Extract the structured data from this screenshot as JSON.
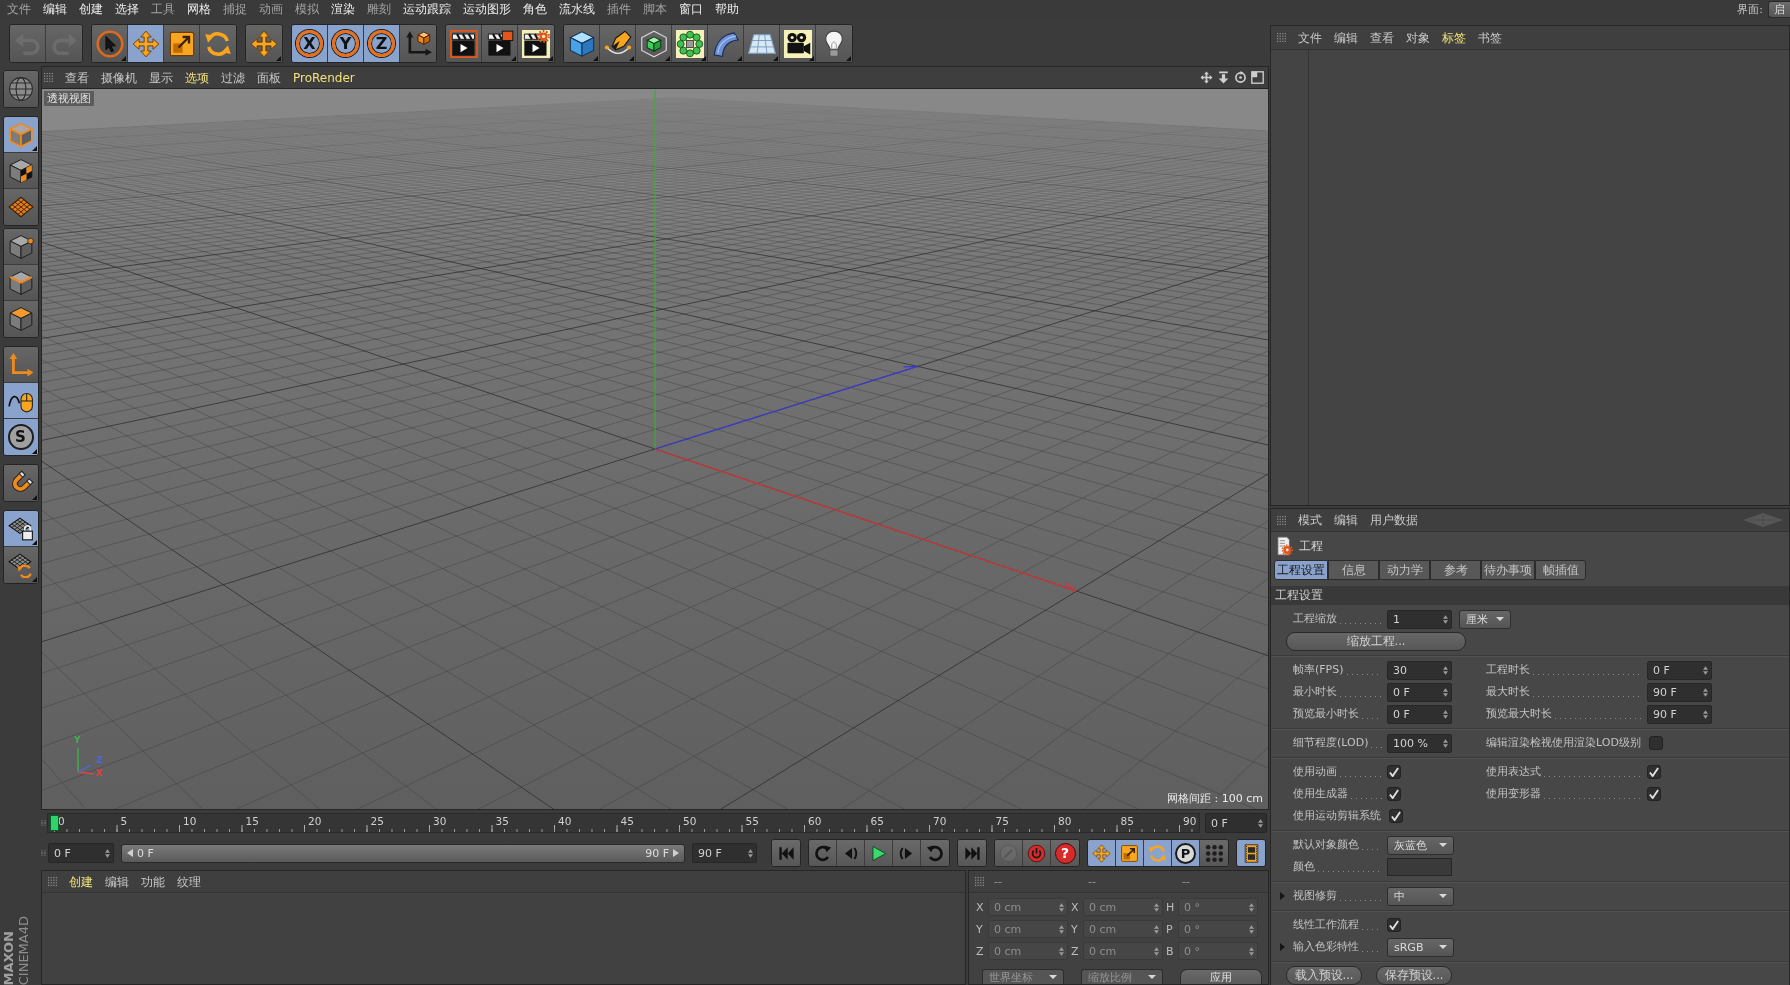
{
  "menu_bar": {
    "items": [
      {
        "label": "文件",
        "dimmed": true
      },
      {
        "label": "编辑",
        "dimmed": false
      },
      {
        "label": "创建",
        "dimmed": false
      },
      {
        "label": "选择",
        "dimmed": false
      },
      {
        "label": "工具",
        "dimmed": true
      },
      {
        "label": "网格",
        "dimmed": false
      },
      {
        "label": "捕捉",
        "dimmed": true
      },
      {
        "label": "动画",
        "dimmed": true
      },
      {
        "label": "模拟",
        "dimmed": true
      },
      {
        "label": "渲染",
        "dimmed": false
      },
      {
        "label": "雕刻",
        "dimmed": true
      },
      {
        "label": "运动跟踪",
        "dimmed": false
      },
      {
        "label": "运动图形",
        "dimmed": false
      },
      {
        "label": "角色",
        "dimmed": false
      },
      {
        "label": "流水线",
        "dimmed": false
      },
      {
        "label": "插件",
        "dimmed": true
      },
      {
        "label": "脚本",
        "dimmed": true
      },
      {
        "label": "窗口",
        "dimmed": false
      },
      {
        "label": "帮助",
        "dimmed": false
      }
    ],
    "layout_label": "界面:",
    "layout_value": "启"
  },
  "main_toolbar": {
    "groups": [
      [
        {
          "kind": "undo",
          "selected": false,
          "disabled": true,
          "submenu": false
        },
        {
          "kind": "redo",
          "selected": false,
          "disabled": true,
          "submenu": false
        }
      ],
      [
        {
          "kind": "live-select",
          "selected": false,
          "disabled": false,
          "submenu": true
        },
        {
          "kind": "move",
          "selected": true,
          "disabled": false,
          "submenu": false
        },
        {
          "kind": "scale",
          "selected": false,
          "disabled": false,
          "submenu": false
        },
        {
          "kind": "rotate",
          "selected": false,
          "disabled": false,
          "submenu": false
        }
      ],
      [
        {
          "kind": "last-tool",
          "selected": false,
          "disabled": false,
          "submenu": true
        }
      ],
      [
        {
          "kind": "axis",
          "label": "X",
          "selected": true,
          "disabled": false,
          "submenu": false
        },
        {
          "kind": "axis",
          "label": "Y",
          "selected": true,
          "disabled": false,
          "submenu": false
        },
        {
          "kind": "axis",
          "label": "Z",
          "selected": true,
          "disabled": false,
          "submenu": false
        },
        {
          "kind": "world-coords",
          "selected": false,
          "disabled": false,
          "submenu": false
        }
      ],
      [
        {
          "kind": "render-view",
          "selected": false,
          "disabled": false,
          "submenu": false
        },
        {
          "kind": "render-viewer",
          "selected": false,
          "disabled": false,
          "submenu": true
        },
        {
          "kind": "render-settings",
          "selected": false,
          "disabled": false,
          "submenu": true
        }
      ],
      [
        {
          "kind": "cube",
          "selected": false,
          "disabled": false,
          "submenu": true
        },
        {
          "kind": "pen",
          "selected": false,
          "disabled": false,
          "submenu": true
        },
        {
          "kind": "subdivision",
          "selected": false,
          "disabled": false,
          "submenu": true
        },
        {
          "kind": "cloner",
          "selected": false,
          "disabled": false,
          "submenu": true
        },
        {
          "kind": "bend",
          "selected": false,
          "disabled": false,
          "submenu": true
        },
        {
          "kind": "floor",
          "selected": false,
          "disabled": false,
          "submenu": true
        },
        {
          "kind": "camera",
          "selected": false,
          "disabled": false,
          "submenu": true
        },
        {
          "kind": "light",
          "selected": false,
          "disabled": false,
          "submenu": true
        }
      ]
    ]
  },
  "left_toolbar": {
    "groups": [
      [
        {
          "kind": "make-editable",
          "selected": false,
          "submenu": false
        }
      ],
      [
        {
          "kind": "model",
          "selected": true,
          "submenu": true
        },
        {
          "kind": "texture",
          "selected": false,
          "submenu": false
        },
        {
          "kind": "workplane",
          "selected": false,
          "submenu": false
        }
      ],
      [
        {
          "kind": "points",
          "selected": false,
          "submenu": false
        },
        {
          "kind": "edges",
          "selected": false,
          "submenu": false
        },
        {
          "kind": "polygons",
          "selected": false,
          "submenu": false
        }
      ],
      [
        {
          "kind": "axis-mode",
          "selected": false,
          "submenu": false
        },
        {
          "kind": "tweak",
          "selected": true,
          "submenu": false
        },
        {
          "kind": "snap",
          "label": "S",
          "selected": true,
          "submenu": true
        }
      ],
      [
        {
          "kind": "magnet",
          "selected": false,
          "submenu": true
        }
      ],
      [
        {
          "kind": "lock-workplane",
          "selected": true,
          "submenu": true
        },
        {
          "kind": "planar-workplane",
          "selected": false,
          "submenu": true
        }
      ]
    ],
    "brand": {
      "company": "MAXON",
      "product": "CINEMA4D"
    }
  },
  "viewport": {
    "menu": [
      {
        "label": "查看",
        "highlighted": false
      },
      {
        "label": "摄像机",
        "highlighted": false
      },
      {
        "label": "显示",
        "highlighted": false
      },
      {
        "label": "选项",
        "highlighted": true
      },
      {
        "label": "过滤",
        "highlighted": false
      },
      {
        "label": "面板",
        "highlighted": false
      },
      {
        "label": "ProRender",
        "highlighted": true
      }
    ],
    "view_name": "透视视图",
    "grid_spacing": "网格间距 : 100 cm",
    "axis_labels": [
      {
        "label": "Y",
        "color": "#3cb44b"
      },
      {
        "label": "Z",
        "color": "#4a68e8"
      },
      {
        "label": "X",
        "color": "#e04444"
      }
    ]
  },
  "timeline": {
    "ruler": {
      "labels": [
        "0",
        "5",
        "10",
        "15",
        "20",
        "25",
        "30",
        "35",
        "40",
        "45",
        "50",
        "55",
        "60",
        "65",
        "70",
        "75",
        "80",
        "85",
        "90"
      ],
      "level": 0
    },
    "current_frame": "0 F",
    "start_frame": "0 F",
    "range": {
      "start": "0 F",
      "end": "90 F"
    },
    "end_frame": "90 F",
    "buttons": [
      [
        {
          "kind": "first-frame",
          "selected": false,
          "disabled": false
        }
      ],
      [
        {
          "kind": "previous-key",
          "selected": false,
          "disabled": false
        },
        {
          "kind": "previous-frame",
          "selected": false,
          "disabled": false
        },
        {
          "kind": "play",
          "selected": false,
          "disabled": false
        },
        {
          "kind": "next-frame",
          "selected": false,
          "disabled": false
        },
        {
          "kind": "next-key",
          "selected": false,
          "disabled": false
        }
      ],
      [
        {
          "kind": "last-frame",
          "selected": false,
          "disabled": false
        }
      ],
      [
        {
          "kind": "record-objects",
          "selected": false,
          "disabled": true
        },
        {
          "kind": "autokey",
          "selected": false,
          "disabled": false
        },
        {
          "kind": "keyframe-selection",
          "label": "?",
          "selected": false,
          "disabled": false
        }
      ],
      [
        {
          "kind": "key-position",
          "selected": true,
          "disabled": false
        },
        {
          "kind": "key-scale",
          "selected": true,
          "disabled": false
        },
        {
          "kind": "key-rotation",
          "selected": true,
          "disabled": false
        },
        {
          "kind": "key-parameter",
          "label": "P",
          "selected": true,
          "disabled": false
        },
        {
          "kind": "key-point",
          "selected": false,
          "disabled": false
        }
      ],
      [
        {
          "kind": "timeline-window",
          "selected": true,
          "disabled": false
        }
      ]
    ]
  },
  "material_manager": {
    "menu": [
      {
        "label": "创建",
        "highlighted": true
      },
      {
        "label": "编辑",
        "highlighted": false
      },
      {
        "label": "功能",
        "highlighted": false
      },
      {
        "label": "纹理",
        "highlighted": false
      }
    ]
  },
  "coordinates": {
    "headers": [
      "--",
      "--",
      "--"
    ],
    "rows": [
      {
        "position_axis": "X",
        "position": "0 cm",
        "size_axis": "X",
        "size": "0 cm",
        "rotation_axis": "H",
        "rotation": "0 °"
      },
      {
        "position_axis": "Y",
        "position": "0 cm",
        "size_axis": "Y",
        "size": "0 cm",
        "rotation_axis": "P",
        "rotation": "0 °"
      },
      {
        "position_axis": "Z",
        "position": "0 cm",
        "size_axis": "Z",
        "size": "0 cm",
        "rotation_axis": "B",
        "rotation": "0 °"
      }
    ],
    "coordinate_mode": "世界坐标",
    "scale_mode": "缩放比例",
    "apply_button": "应用"
  },
  "object_manager": {
    "menu": [
      {
        "label": "文件",
        "highlighted": false
      },
      {
        "label": "编辑",
        "highlighted": false
      },
      {
        "label": "查看",
        "highlighted": false
      },
      {
        "label": "对象",
        "highlighted": false
      },
      {
        "label": "标签",
        "highlighted": true
      },
      {
        "label": "书签",
        "highlighted": false
      }
    ]
  },
  "attributes": {
    "menu": [
      {
        "label": "模式",
        "highlighted": false
      },
      {
        "label": "编辑",
        "highlighted": false
      },
      {
        "label": "用户数据",
        "highlighted": false
      }
    ],
    "object_name": "工程",
    "tabs": [
      {
        "label": "工程设置",
        "selected": true
      },
      {
        "label": "信息",
        "selected": false
      },
      {
        "label": "动力学",
        "selected": false
      },
      {
        "label": "参考",
        "selected": false
      },
      {
        "label": "待办事项",
        "selected": false
      },
      {
        "label": "帧插值",
        "selected": false
      }
    ],
    "section": "工程设置",
    "groups": [
      [
        [
          {
            "kind": "number",
            "label": "工程缩放",
            "value": "1",
            "unit": "厘米",
            "foldable": false
          }
        ],
        [
          {
            "kind": "button",
            "label": "缩放工程..."
          }
        ]
      ],
      [
        [
          {
            "kind": "number",
            "label": "帧率(FPS)",
            "value": "30",
            "foldable": false
          },
          {
            "kind": "number",
            "label": "工程时长",
            "value": "0 F",
            "foldable": false
          }
        ],
        [
          {
            "kind": "number",
            "label": "最小时长",
            "value": "0 F",
            "foldable": false
          },
          {
            "kind": "number",
            "label": "最大时长",
            "value": "90 F",
            "foldable": false
          }
        ],
        [
          {
            "kind": "number",
            "label": "预览最小时长",
            "value": "0 F",
            "foldable": false
          },
          {
            "kind": "number",
            "label": "预览最大时长",
            "value": "90 F",
            "foldable": false
          }
        ]
      ],
      [
        [
          {
            "kind": "number",
            "label": "细节程度(LOD)",
            "value": "100 %",
            "foldable": false
          },
          {
            "kind": "checkbox",
            "label": "编辑渲染检视使用渲染LOD级别",
            "checked": false,
            "foldable": false
          }
        ]
      ],
      [
        [
          {
            "kind": "checkbox",
            "label": "使用动画",
            "checked": true,
            "foldable": false
          },
          {
            "kind": "checkbox",
            "label": "使用表达式",
            "checked": true,
            "foldable": false
          }
        ],
        [
          {
            "kind": "checkbox",
            "label": "使用生成器",
            "checked": true,
            "foldable": false
          },
          {
            "kind": "checkbox",
            "label": "使用变形器",
            "checked": true,
            "foldable": false
          }
        ],
        [
          {
            "kind": "checkbox",
            "label": "使用运动剪辑系统",
            "checked": true,
            "foldable": false
          }
        ]
      ],
      [
        [
          {
            "kind": "dropdown",
            "label": "默认对象颜色",
            "value": "灰蓝色",
            "foldable": false
          }
        ],
        [
          {
            "kind": "color",
            "label": "颜色",
            "foldable": false
          }
        ]
      ],
      [
        [
          {
            "kind": "dropdown",
            "label": "视图修剪",
            "value": "中",
            "foldable": true
          }
        ]
      ],
      [
        [
          {
            "kind": "checkbox",
            "label": "线性工作流程",
            "checked": true,
            "foldable": false
          }
        ],
        [
          {
            "kind": "dropdown",
            "label": "输入色彩特性",
            "value": "sRGB",
            "foldable": true
          }
        ]
      ]
    ],
    "footer_buttons": [
      "载入预设...",
      "保存预设..."
    ]
  }
}
